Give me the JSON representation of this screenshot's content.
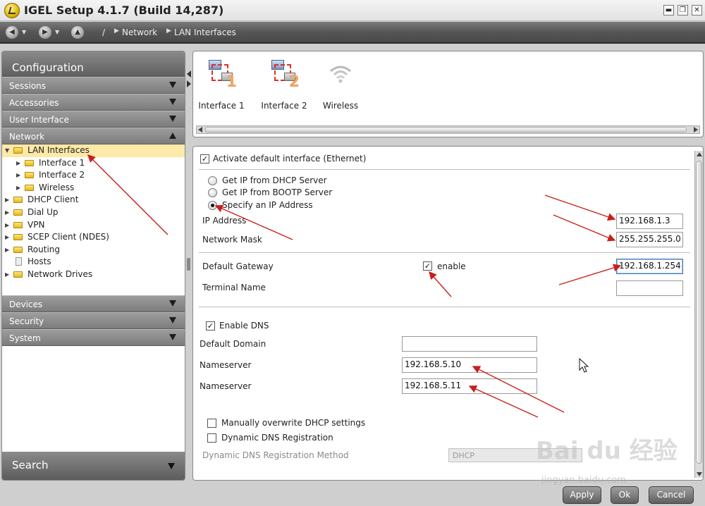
{
  "window": {
    "title": "IGEL Setup 4.1.7 (Build 14,287)",
    "minimize_glyph": "▬",
    "restore_glyph": "❐",
    "close_glyph": "✕"
  },
  "nav": {
    "back_glyph": "◀",
    "forward_glyph": "▶",
    "home_glyph": "▲",
    "root_sep": "/",
    "breadcrumbs": [
      "Network",
      "LAN Interfaces"
    ]
  },
  "sidebar": {
    "header": "Configuration",
    "sections_top": [
      "Sessions",
      "Accessories",
      "User Interface",
      "Network"
    ],
    "tree": [
      {
        "label": "LAN Interfaces",
        "level": 0,
        "expander": "▼",
        "selected": true
      },
      {
        "label": "Interface 1",
        "level": 1,
        "expander": "▶"
      },
      {
        "label": "Interface 2",
        "level": 1,
        "expander": "▶"
      },
      {
        "label": "Wireless",
        "level": 1,
        "expander": "▶"
      },
      {
        "label": "DHCP Client",
        "level": 0,
        "expander": "▶"
      },
      {
        "label": "Dial Up",
        "level": 0,
        "expander": "▶"
      },
      {
        "label": "VPN",
        "level": 0,
        "expander": "▶"
      },
      {
        "label": "SCEP Client (NDES)",
        "level": 0,
        "expander": "▶"
      },
      {
        "label": "Routing",
        "level": 0,
        "expander": "▶"
      },
      {
        "label": "Hosts",
        "level": 0,
        "expander": "",
        "doc": true
      },
      {
        "label": "Network Drives",
        "level": 0,
        "expander": "▶"
      }
    ],
    "sections_bottom": [
      "Devices",
      "Security",
      "System"
    ],
    "search": "Search"
  },
  "interfaces": {
    "items": [
      {
        "label": "Interface 1",
        "num": "1"
      },
      {
        "label": "Interface 2",
        "num": "2"
      },
      {
        "label": "Wireless"
      }
    ]
  },
  "form": {
    "activate_default": "Activate default interface (Ethernet)",
    "radio_dhcp": "Get IP from DHCP Server",
    "radio_bootp": "Get IP from BOOTP Server",
    "radio_specify": "Specify an IP Address",
    "ip_label": "IP Address",
    "ip_value": "192.168.1.3",
    "mask_label": "Network Mask",
    "mask_value": "255.255.255.0",
    "gateway_label": "Default Gateway",
    "gateway_enable": "enable",
    "gateway_value": "192.168.1.254",
    "terminal_label": "Terminal Name",
    "terminal_value": "",
    "enable_dns": "Enable DNS",
    "domain_label": "Default Domain",
    "domain_value": "",
    "ns1_label": "Nameserver",
    "ns1_value": "192.168.5.10",
    "ns2_label": "Nameserver",
    "ns2_value": "192.168.5.11",
    "manual_overwrite": "Manually overwrite DHCP settings",
    "dynamic_dns": "Dynamic DNS Registration",
    "ddns_method_label": "Dynamic DNS Registration Method",
    "ddns_method_value": "DHCP",
    "check_glyph": "✓"
  },
  "buttons": {
    "apply": "Apply",
    "ok": "Ok",
    "cancel": "Cancel"
  },
  "watermark": {
    "main": "Bai du 经验",
    "sub": "jingyan.baidu.com"
  },
  "colors": {
    "annotation_arrow": "#c8201b",
    "selected_row": "#fde9a8",
    "header_grey": "#6e6e6e"
  }
}
